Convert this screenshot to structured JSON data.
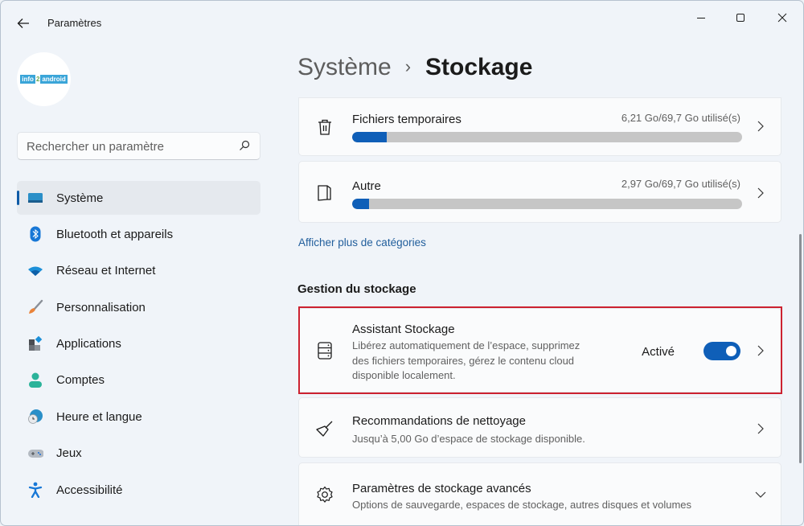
{
  "window": {
    "app_title": "Paramètres",
    "controls": {
      "minimize": "minimize-icon",
      "maximize": "maximize-icon",
      "close": "close-icon"
    }
  },
  "profile": {
    "logo_parts": [
      "info",
      "2",
      "android"
    ]
  },
  "search": {
    "placeholder": "Rechercher un paramètre",
    "value": ""
  },
  "sidebar": {
    "items": [
      {
        "label": "Système",
        "icon": "monitor-icon",
        "active": true
      },
      {
        "label": "Bluetooth et appareils",
        "icon": "bluetooth-icon"
      },
      {
        "label": "Réseau et Internet",
        "icon": "wifi-icon"
      },
      {
        "label": "Personnalisation",
        "icon": "brush-icon"
      },
      {
        "label": "Applications",
        "icon": "apps-icon"
      },
      {
        "label": "Comptes",
        "icon": "person-icon"
      },
      {
        "label": "Heure et langue",
        "icon": "clock-globe-icon"
      },
      {
        "label": "Jeux",
        "icon": "gamepad-icon"
      },
      {
        "label": "Accessibilité",
        "icon": "accessibility-icon"
      }
    ]
  },
  "breadcrumb": {
    "parent": "Système",
    "separator": "›",
    "current": "Stockage"
  },
  "categories": [
    {
      "title": "Fichiers temporaires",
      "usage": "6,21 Go/69,7 Go utilisé(s)",
      "used_gb": 6.21,
      "total_gb": 69.7,
      "icon": "trash-icon"
    },
    {
      "title": "Autre",
      "usage": "2,97 Go/69,7 Go utilisé(s)",
      "used_gb": 2.97,
      "total_gb": 69.7,
      "icon": "folder-icon"
    }
  ],
  "more_categories_link": "Afficher plus de catégories",
  "storage_management": {
    "section_title": "Gestion du stockage",
    "storage_sense": {
      "title": "Assistant Stockage",
      "description": "Libérez automatiquement de l’espace, supprimez des fichiers temporaires, gérez le contenu cloud disponible localement.",
      "status": "Activé",
      "enabled": true
    },
    "cleanup": {
      "title": "Recommandations de nettoyage",
      "description": "Jusqu’à 5,00 Go d’espace de stockage disponible."
    },
    "advanced": {
      "title": "Paramètres de stockage avancés",
      "description": "Options de sauvegarde, espaces de stockage, autres disques et volumes"
    }
  },
  "colors": {
    "accent": "#0f5fb8",
    "highlight_border": "#cc2230",
    "link": "#215e9c"
  }
}
